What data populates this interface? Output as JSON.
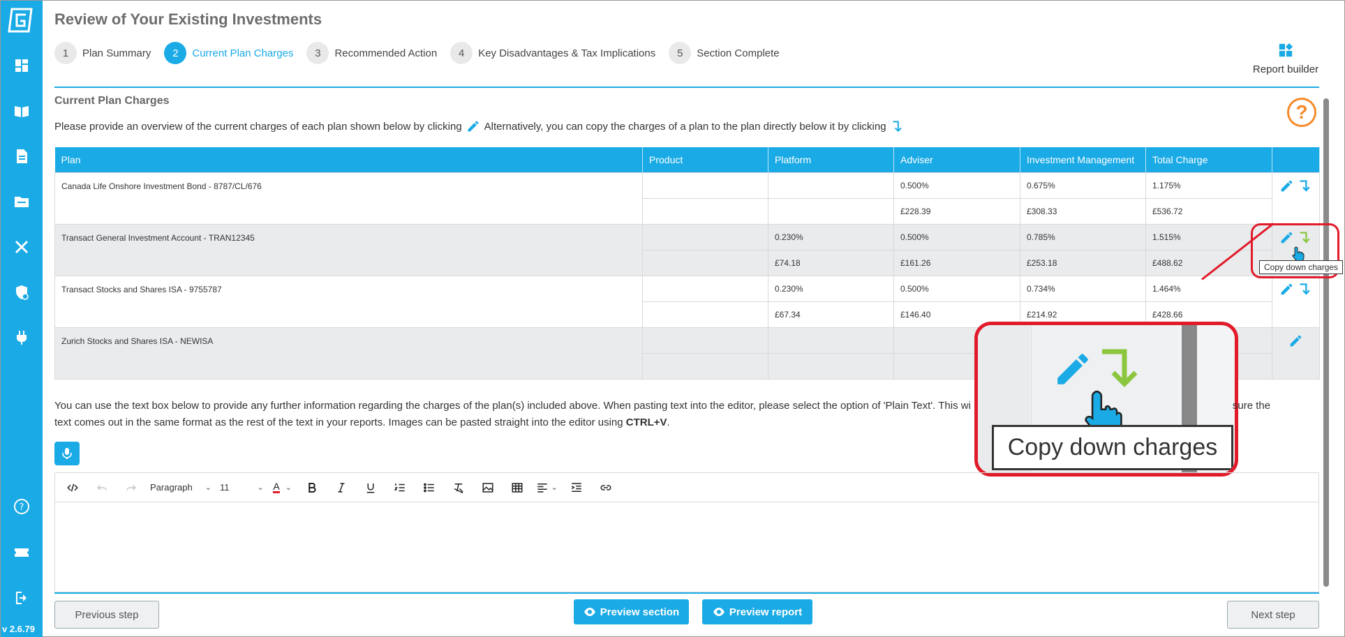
{
  "sidebar": {
    "version": "v 2.6.79",
    "icons": [
      "logo-icon",
      "dashboard-icon",
      "book-icon",
      "document-icon",
      "folder-icon",
      "tools-icon",
      "shield-icon",
      "plug-icon",
      "help-circle-icon",
      "ticket-icon",
      "logout-icon"
    ]
  },
  "header": {
    "title": "Review of Your Existing Investments",
    "report_builder": "Report builder",
    "steps": [
      {
        "num": "1",
        "label": "Plan Summary"
      },
      {
        "num": "2",
        "label": "Current Plan Charges"
      },
      {
        "num": "3",
        "label": "Recommended Action"
      },
      {
        "num": "4",
        "label": "Key Disadvantages & Tax Implications"
      },
      {
        "num": "5",
        "label": "Section Complete"
      }
    ],
    "active_step": "2"
  },
  "section": {
    "title": "Current Plan Charges",
    "instruction_a": "Please provide an overview of the current charges of each plan shown below by clicking",
    "instruction_b": "Alternatively, you can copy the charges of a plan to the plan directly below it by clicking",
    "help": "?"
  },
  "table": {
    "headers": [
      "Plan",
      "Product",
      "Platform",
      "Adviser",
      "Investment Management",
      "Total Charge",
      ""
    ],
    "rows": [
      {
        "plan": "Canada Life Onshore Investment Bond - 8787/CL/676",
        "pct": [
          "",
          "",
          "0.500%",
          "0.675%",
          "1.175%"
        ],
        "amt": [
          "",
          "",
          "£228.39",
          "£308.33",
          "£536.72"
        ]
      },
      {
        "plan": "Transact General Investment Account - TRAN12345",
        "pct": [
          "",
          "0.230%",
          "0.500%",
          "0.785%",
          "1.515%"
        ],
        "amt": [
          "",
          "£74.18",
          "£161.26",
          "£253.18",
          "£488.62"
        ]
      },
      {
        "plan": "Transact Stocks and Shares ISA - 9755787",
        "pct": [
          "",
          "0.230%",
          "0.500%",
          "0.734%",
          "1.464%"
        ],
        "amt": [
          "",
          "£67.34",
          "£146.40",
          "£214.92",
          "£428.66"
        ]
      },
      {
        "plan": "Zurich Stocks and Shares ISA - NEWISA",
        "pct": [
          "",
          "",
          "",
          "",
          ""
        ],
        "amt": [
          "",
          "",
          "",
          "",
          ""
        ]
      }
    ]
  },
  "tooltip": "Copy down charges",
  "further_info": {
    "part1": "You can use the text box below to provide any further information regarding the charges of the plan(s) included above. When pasting text into the editor, please select the option of 'Plain Text'. This wi",
    "part2": "sure the text comes out in the same format as the rest of the text in your reports. Images can be pasted straight into the editor using",
    "shortcut": "CTRL+V",
    "end": "."
  },
  "editor": {
    "block_format": "Paragraph",
    "font_size": "11",
    "font_color_label": "A"
  },
  "footer": {
    "previous": "Previous step",
    "preview_section": "Preview section",
    "preview_report": "Preview report",
    "next": "Next step"
  },
  "colors": {
    "accent": "#1aaae5",
    "highlight": "#e11b2a",
    "copy_green": "#8cc63f",
    "help_orange": "#f58a2a"
  }
}
